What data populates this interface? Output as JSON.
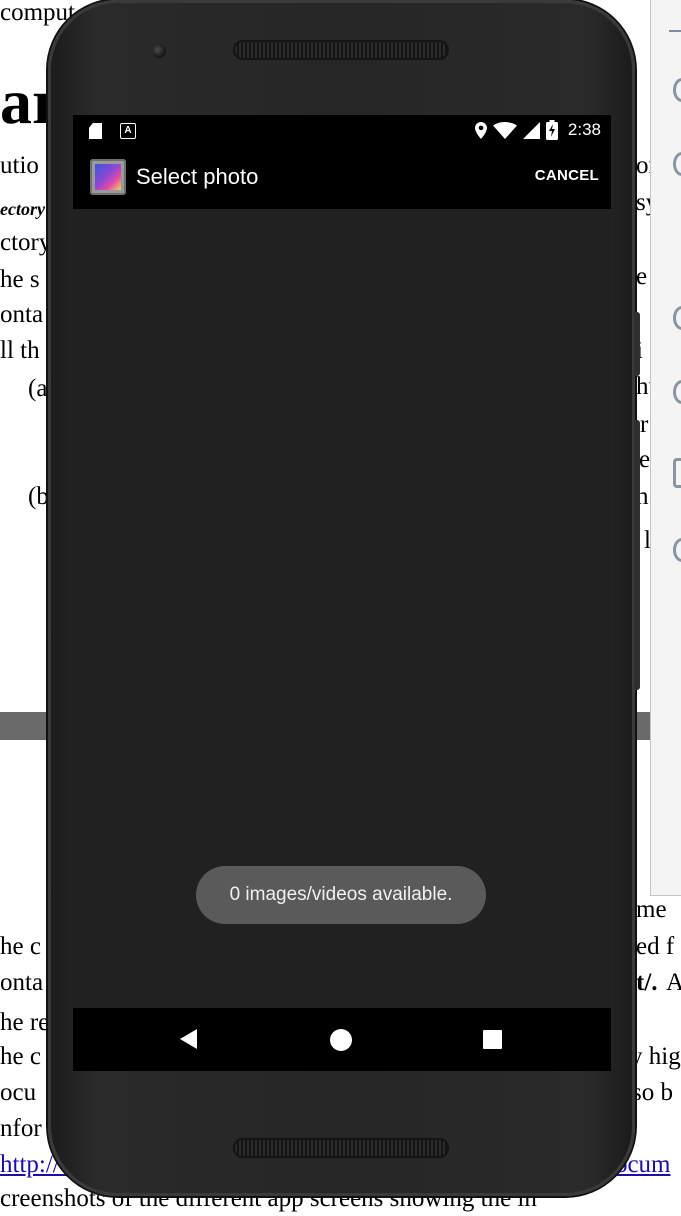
{
  "document": {
    "heading": "ar",
    "lines": [
      "comput",
      "utio",
      "ectory",
      "ctory",
      "he s",
      "onta",
      "ll th",
      "(a",
      "(b",
      "he c",
      "onta",
      "he re",
      "he c",
      "ocu",
      "nfor",
      "creenshots of the different app screens showing the in"
    ],
    "right_fragments": [
      "or",
      "sy",
      "e",
      "i",
      "hu",
      "r",
      "le",
      "h",
      "l",
      "me",
      "ed f",
      "t/.",
      "A",
      "y hig",
      "so b"
    ],
    "link_left": "http://v",
    "link_right": "locum"
  },
  "status_bar": {
    "time": "2:38",
    "left_icons": [
      "sd-card-icon",
      "a-notification-icon"
    ],
    "right_icons": [
      "location-icon",
      "wifi-icon",
      "cell-signal-icon",
      "battery-charging-icon"
    ]
  },
  "toolbar": {
    "title": "Select photo",
    "cancel_label": "CANCEL",
    "app_icon": "gallery-app-icon"
  },
  "toast": {
    "message": "0 images/videos available."
  },
  "nav_bar": {
    "back_icon": "back-triangle-icon",
    "home_icon": "home-circle-icon",
    "recents_icon": "recents-square-icon"
  },
  "colors": {
    "screen_background": "#212121",
    "bars": "#000000",
    "toast_background": "#5a5a5a",
    "phone_body": "#262626",
    "link": "#1a0dab"
  }
}
